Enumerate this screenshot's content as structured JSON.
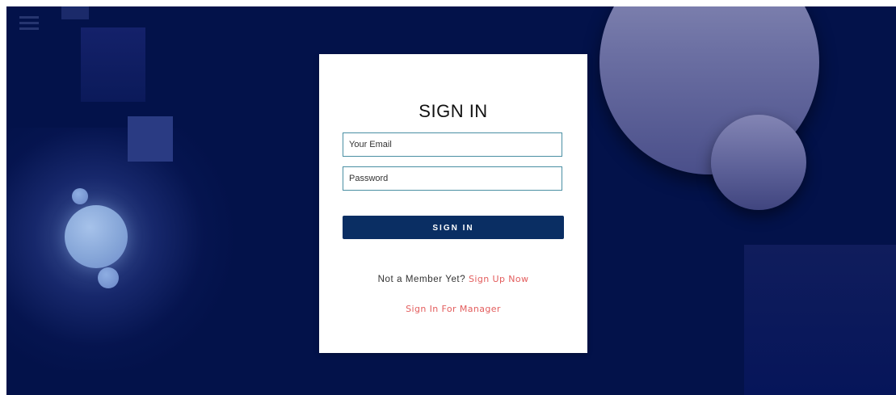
{
  "signin": {
    "title": "SIGN IN",
    "email_placeholder": "Your Email",
    "password_placeholder": "Password",
    "submit_label": "SIGN IN",
    "member_prompt": "Not a Member Yet?",
    "signup_link": "Sign Up Now",
    "manager_link": "Sign In For Manager"
  },
  "colors": {
    "background": "#03124a",
    "button": "#0a2e63",
    "link": "#e35d5d",
    "field_border": "#4a8fa3"
  },
  "icons": {
    "menu": "hamburger-icon"
  }
}
